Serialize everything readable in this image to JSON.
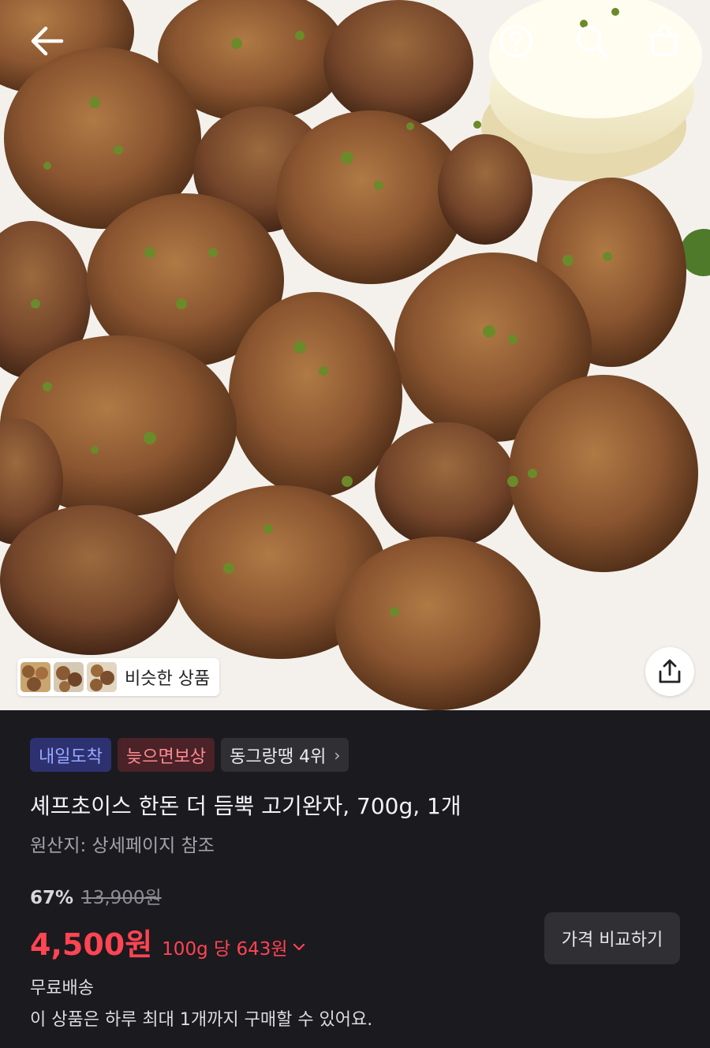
{
  "hero": {
    "image_subject": "meatballs-photo",
    "icons": {
      "back": "arrow-left-icon",
      "help": "question-circle-icon",
      "search": "search-icon",
      "cart": "shopping-bag-icon",
      "share": "share-icon"
    },
    "similar_label": "비슷한 상품"
  },
  "badges": [
    {
      "label": "내일도착"
    },
    {
      "label": "늦으면보상"
    },
    {
      "label": "동그랑땡 4위"
    }
  ],
  "product": {
    "title": "셰프초이스 한돈 더 듬뿍 고기완자, 700g, 1개",
    "origin": "원산지: 상세페이지 참조"
  },
  "price": {
    "discount": "67%",
    "original": "13,900원",
    "sale": "4,500원",
    "unit": "100g 당 643원",
    "compare_label": "가격 비교하기"
  },
  "shipping": {
    "label": "무료배송",
    "limit_notice": "이 상품은 하루 최대 1개까지 구매할 수 있어요."
  },
  "colors": {
    "panel_bg": "#1b1a1f",
    "accent_red": "#ff4452",
    "badge_blue_text": "#9aa8ff",
    "badge_red_text": "#ff8b90"
  }
}
